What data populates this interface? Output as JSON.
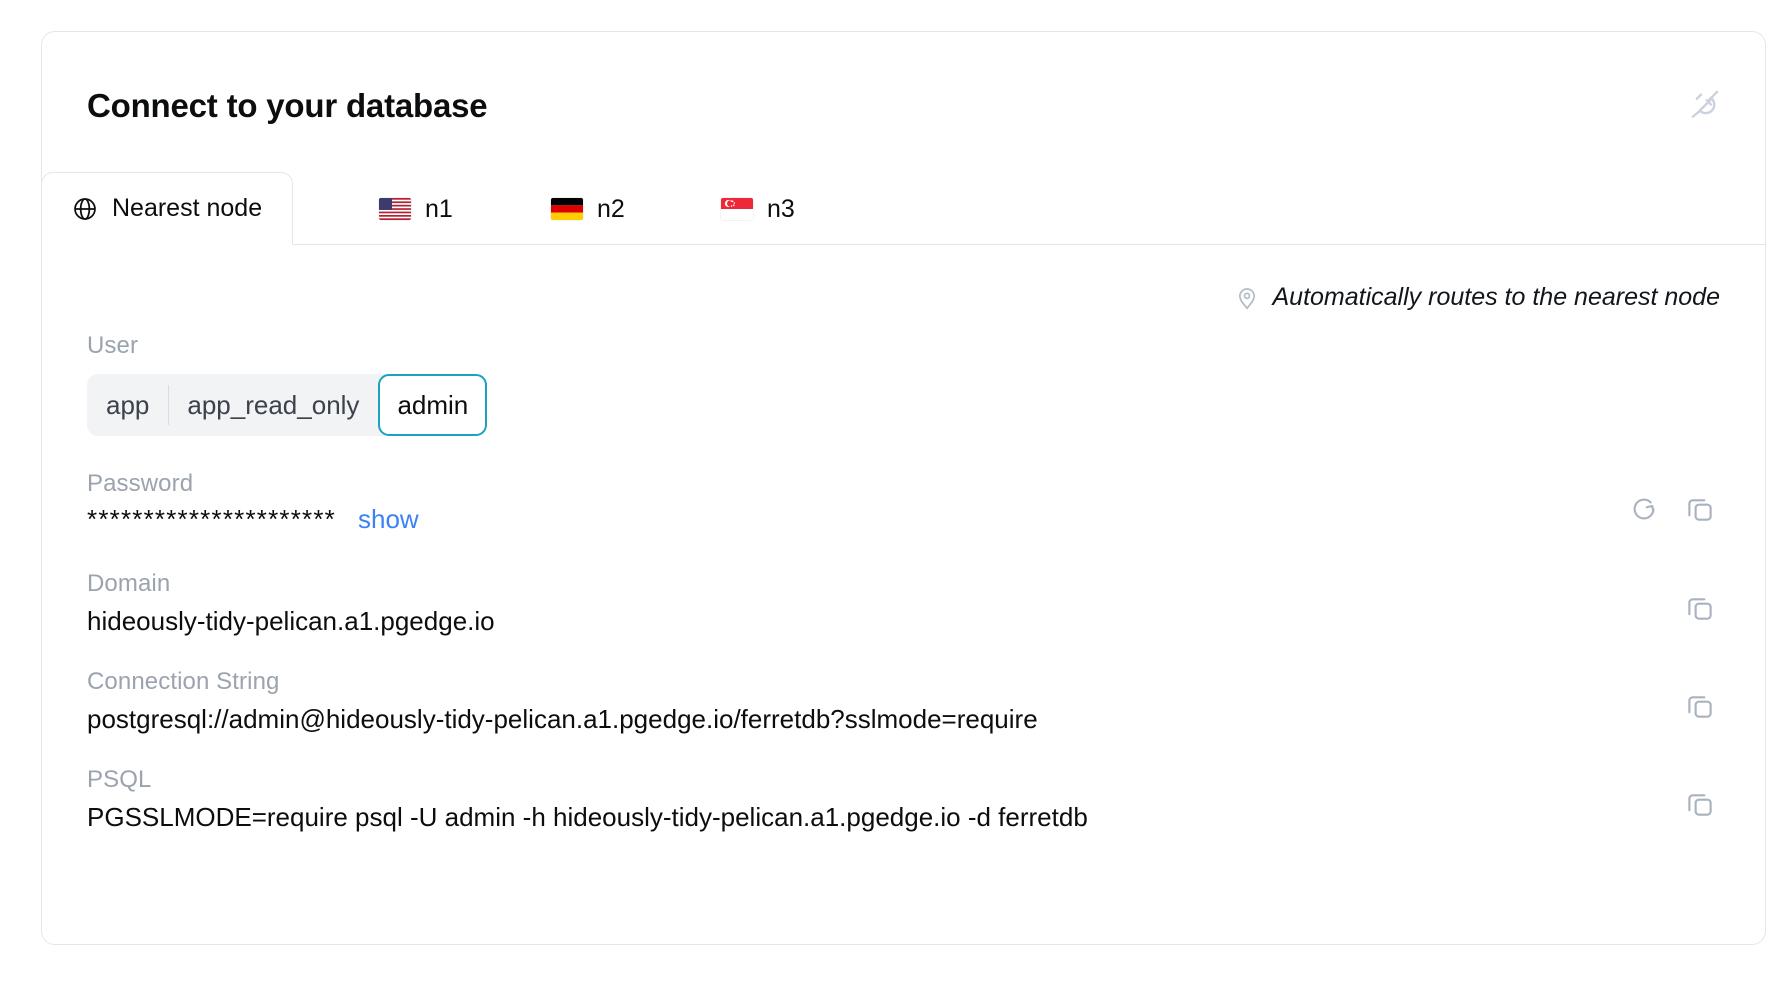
{
  "card": {
    "title": "Connect to your database",
    "plug_icon": "plug-icon"
  },
  "tabs": [
    {
      "label": "Nearest node",
      "icon": "globe-icon",
      "active": true
    },
    {
      "label": "n1",
      "icon": "flag-us-icon",
      "active": false
    },
    {
      "label": "n2",
      "icon": "flag-de-icon",
      "active": false
    },
    {
      "label": "n3",
      "icon": "flag-sg-icon",
      "active": false
    }
  ],
  "note": {
    "icon": "map-pin-icon",
    "text": "Automatically routes to the nearest node"
  },
  "fields": {
    "user": {
      "label": "User",
      "options": [
        "app",
        "app_read_only",
        "admin"
      ],
      "selected": "admin"
    },
    "password": {
      "label": "Password",
      "masked_value": "**********************",
      "show_label": "show",
      "refresh_icon": "refresh-icon",
      "copy_icon": "copy-icon"
    },
    "domain": {
      "label": "Domain",
      "value": "hideously-tidy-pelican.a1.pgedge.io",
      "copy_icon": "copy-icon"
    },
    "connection_string": {
      "label": "Connection String",
      "value": "postgresql://admin@hideously-tidy-pelican.a1.pgedge.io/ferretdb?sslmode=require",
      "copy_icon": "copy-icon"
    },
    "psql": {
      "label": "PSQL",
      "value": "PGSSLMODE=require psql -U admin -h hideously-tidy-pelican.a1.pgedge.io -d ferretdb",
      "copy_icon": "copy-icon"
    }
  },
  "colors": {
    "accent_teal": "#1aa3ba",
    "link_blue": "#3b82f6",
    "label_gray": "#9aa3ae",
    "icon_gray": "#a9b2bf",
    "border": "#e3e7ec",
    "segment_bg": "#f1f3f5"
  }
}
